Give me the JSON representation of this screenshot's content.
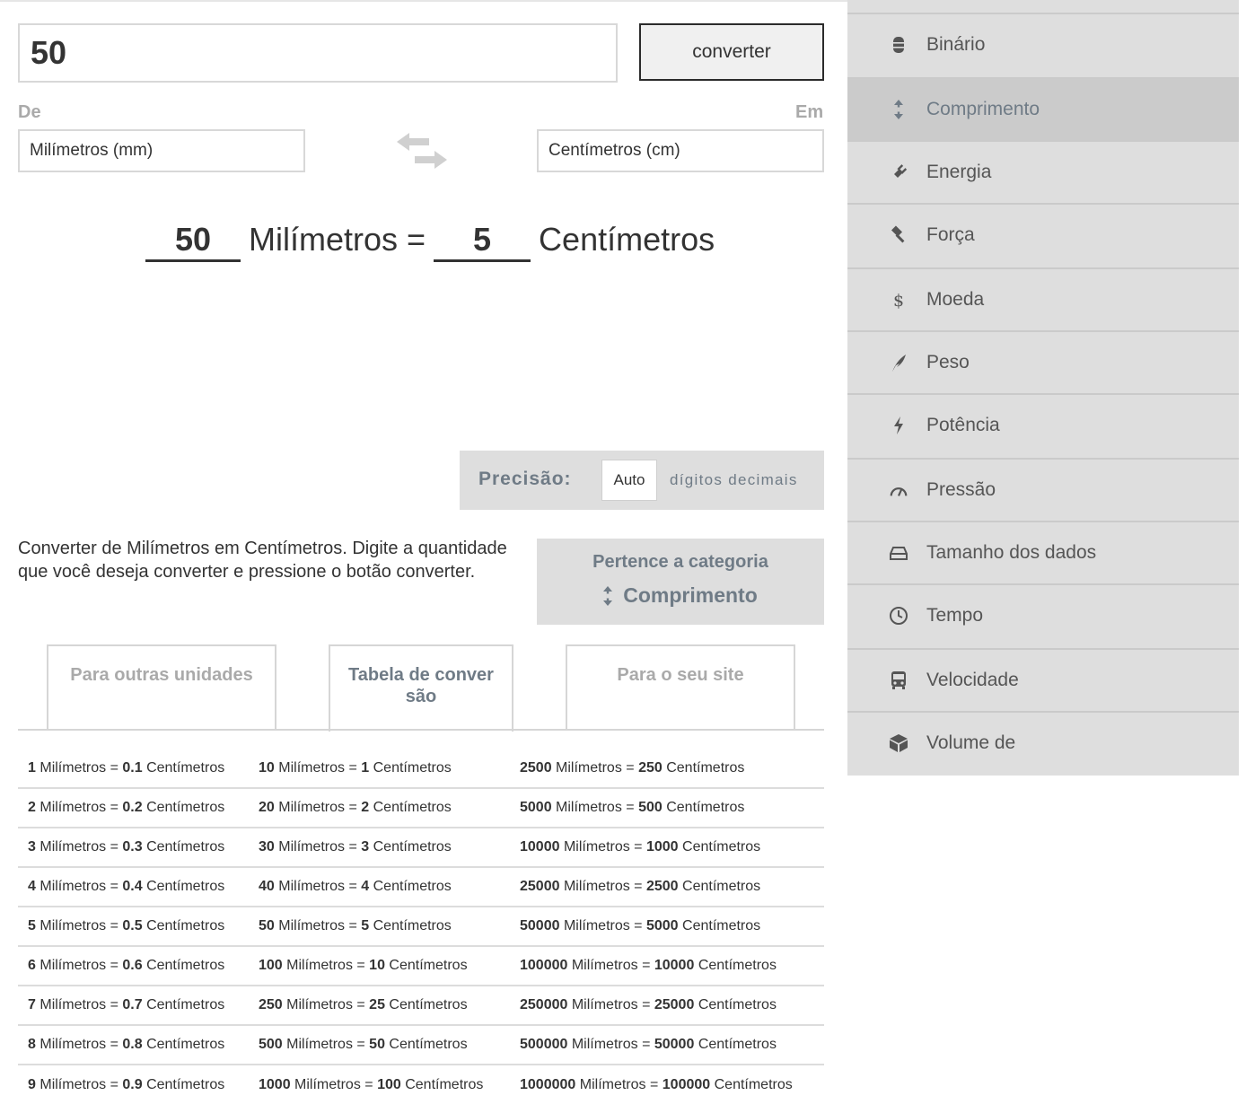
{
  "converter": {
    "amount_value": "50",
    "convert_label": "converter",
    "from_label": "De",
    "to_label": "Em",
    "from_unit": "Milímetros (mm)",
    "to_unit": "Centímetros (cm)"
  },
  "result": {
    "input_value": "50",
    "from_word": "Milímetros =",
    "output_value": "5",
    "to_word": "Centímetros"
  },
  "precision": {
    "label": "Precisão:",
    "value": "Auto",
    "suffix": "dígitos decimais"
  },
  "description": "Converter de Milímetros em Centímetros. Digite a quantidade que você deseja converter e pressione o botão converter.",
  "category": {
    "title": "Pertence a categoria",
    "link": "Comprimento"
  },
  "tabs": [
    {
      "label": "Para outras unidades"
    },
    {
      "label": "Tabela de conver são"
    },
    {
      "label": "Para o seu site"
    }
  ],
  "units": {
    "from": "Milímetros",
    "to": "Centímetros"
  },
  "table": {
    "col1": [
      {
        "a": "1",
        "b": "0.1"
      },
      {
        "a": "2",
        "b": "0.2"
      },
      {
        "a": "3",
        "b": "0.3"
      },
      {
        "a": "4",
        "b": "0.4"
      },
      {
        "a": "5",
        "b": "0.5"
      },
      {
        "a": "6",
        "b": "0.6"
      },
      {
        "a": "7",
        "b": "0.7"
      },
      {
        "a": "8",
        "b": "0.8"
      },
      {
        "a": "9",
        "b": "0.9"
      }
    ],
    "col2": [
      {
        "a": "10",
        "b": "1"
      },
      {
        "a": "20",
        "b": "2"
      },
      {
        "a": "30",
        "b": "3"
      },
      {
        "a": "40",
        "b": "4"
      },
      {
        "a": "50",
        "b": "5"
      },
      {
        "a": "100",
        "b": "10"
      },
      {
        "a": "250",
        "b": "25"
      },
      {
        "a": "500",
        "b": "50"
      },
      {
        "a": "1000",
        "b": "100"
      }
    ],
    "col3": [
      {
        "a": "2500",
        "b": "250"
      },
      {
        "a": "5000",
        "b": "500"
      },
      {
        "a": "10000",
        "b": "1000"
      },
      {
        "a": "25000",
        "b": "2500"
      },
      {
        "a": "50000",
        "b": "5000"
      },
      {
        "a": "100000",
        "b": "10000"
      },
      {
        "a": "250000",
        "b": "25000"
      },
      {
        "a": "500000",
        "b": "50000"
      },
      {
        "a": "1000000",
        "b": "100000"
      }
    ]
  },
  "sidebar": {
    "items": [
      {
        "label": "Binário",
        "icon": "database-icon"
      },
      {
        "label": "Comprimento",
        "icon": "vertical-arrows-icon",
        "active": true
      },
      {
        "label": "Energia",
        "icon": "plug-icon"
      },
      {
        "label": "Força",
        "icon": "gavel-icon"
      },
      {
        "label": "Moeda",
        "icon": "dollar-icon"
      },
      {
        "label": "Peso",
        "icon": "feather-icon"
      },
      {
        "label": "Potência",
        "icon": "bolt-icon"
      },
      {
        "label": "Pressão",
        "icon": "gauge-icon"
      },
      {
        "label": "Tamanho dos dados",
        "icon": "hard-drive-icon"
      },
      {
        "label": "Tempo",
        "icon": "clock-icon"
      },
      {
        "label": "Velocidade",
        "icon": "bus-icon"
      },
      {
        "label": "Volume de",
        "icon": "cube-icon"
      }
    ]
  },
  "colors": {
    "accent_text": "#6f7b86",
    "sidebar_bg": "#dedede",
    "sidebar_active_bg": "#cbcbcb",
    "muted_label": "#aaaaaa"
  }
}
